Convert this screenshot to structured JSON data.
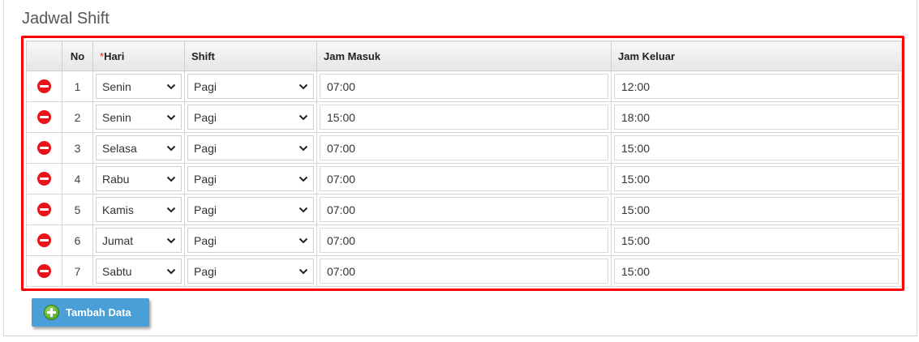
{
  "section_title": "Jadwal Shift",
  "table": {
    "headers": {
      "no": "No",
      "required_mark": "*",
      "hari": "Hari",
      "shift": "Shift",
      "jam_masuk": "Jam Masuk",
      "jam_keluar": "Jam Keluar"
    },
    "rows": [
      {
        "no": "1",
        "hari": "Senin",
        "shift": "Pagi",
        "jam_masuk": "07:00",
        "jam_keluar": "12:00"
      },
      {
        "no": "2",
        "hari": "Senin",
        "shift": "Pagi",
        "jam_masuk": "15:00",
        "jam_keluar": "18:00"
      },
      {
        "no": "3",
        "hari": "Selasa",
        "shift": "Pagi",
        "jam_masuk": "07:00",
        "jam_keluar": "15:00"
      },
      {
        "no": "4",
        "hari": "Rabu",
        "shift": "Pagi",
        "jam_masuk": "07:00",
        "jam_keluar": "15:00"
      },
      {
        "no": "5",
        "hari": "Kamis",
        "shift": "Pagi",
        "jam_masuk": "07:00",
        "jam_keluar": "15:00"
      },
      {
        "no": "6",
        "hari": "Jumat",
        "shift": "Pagi",
        "jam_masuk": "07:00",
        "jam_keluar": "15:00"
      },
      {
        "no": "7",
        "hari": "Sabtu",
        "shift": "Pagi",
        "jam_masuk": "07:00",
        "jam_keluar": "15:00"
      }
    ]
  },
  "add_button": {
    "label": "Tambah Data",
    "icon": "plus-circle-icon"
  },
  "row_action_icon": "remove-circle-icon",
  "colors": {
    "highlight_border": "#ff0000",
    "remove_icon": "#e8141a",
    "button_bg": "#4a9fd8",
    "add_icon": "#3d9a16"
  }
}
